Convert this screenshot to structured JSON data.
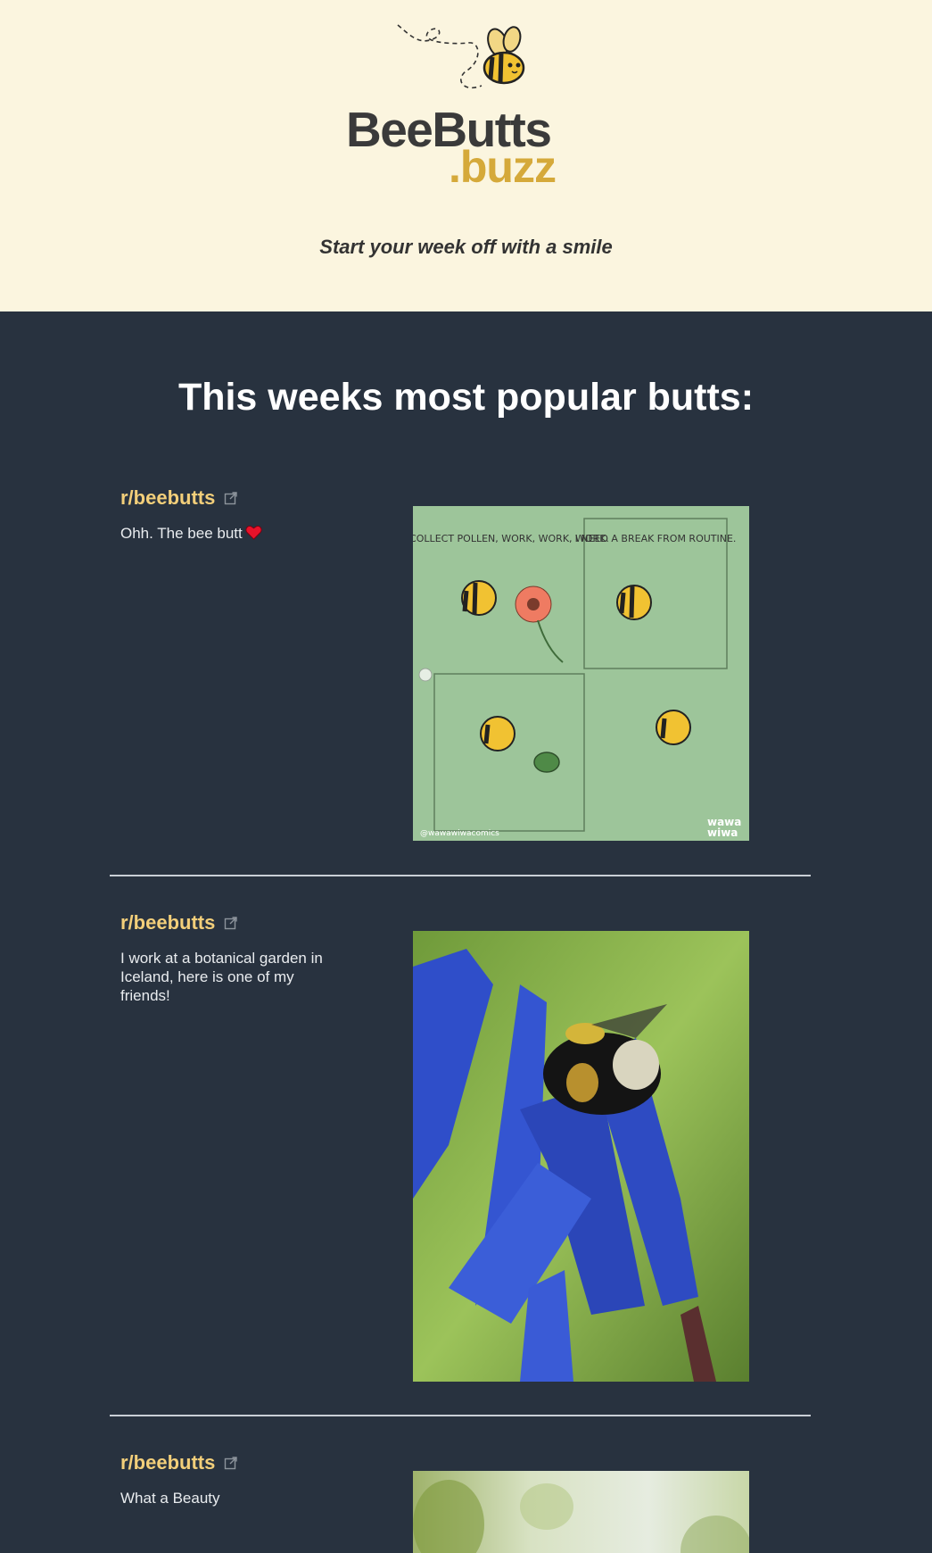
{
  "header": {
    "logo_brand": "BeeButts",
    "logo_domain": ".buzz",
    "tagline": "Start your week off with a smile"
  },
  "main": {
    "title": "This weeks most popular butts:"
  },
  "posts": [
    {
      "subreddit": "r/beebutts",
      "text": "Ohh. The bee butt",
      "image": {
        "kind": "comic",
        "panel_1_text": "COLLECT POLLEN, WORK, WORK, WORK.",
        "panel_2_text": "I NEED A BREAK FROM ROUTINE.",
        "credit": "@wawawiwacomics",
        "brand_line1": "wawa",
        "brand_line2": "wiwa"
      }
    },
    {
      "subreddit": "r/beebutts",
      "text": "I work at a botanical garden in Iceland, here is one of my friends!",
      "image": {
        "kind": "photo"
      }
    },
    {
      "subreddit": "r/beebutts",
      "text": "What a Beauty",
      "image": {
        "kind": "photo"
      }
    }
  ],
  "colors": {
    "header_bg": "#fbf5df",
    "main_bg": "#28323f",
    "subreddit_link": "#f3cf7a",
    "logo_dark": "#3a3a3a",
    "logo_gold": "#d5a93a"
  },
  "icons": [
    "external-link-icon",
    "heart-icon",
    "bee-icon"
  ]
}
